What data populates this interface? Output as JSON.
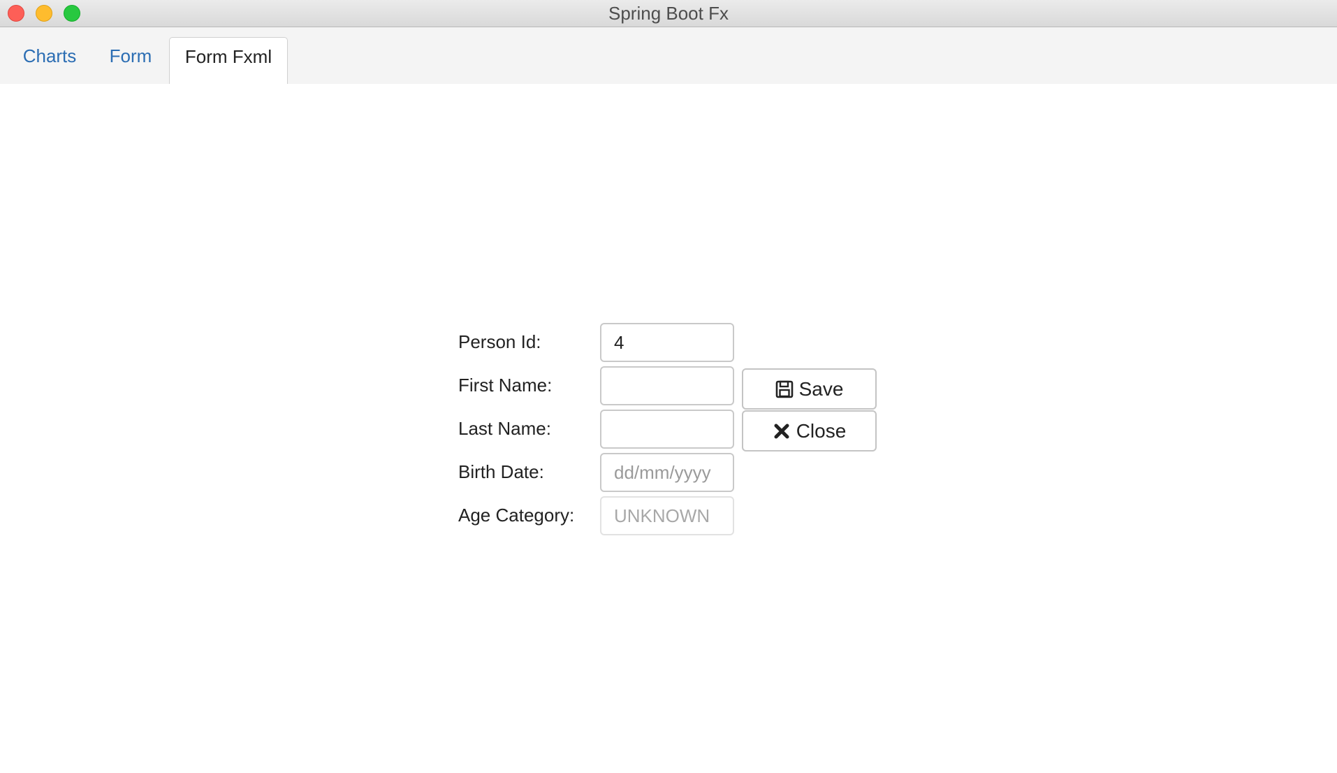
{
  "window": {
    "title": "Spring Boot Fx"
  },
  "tabs": [
    {
      "label": "Charts",
      "selected": false
    },
    {
      "label": "Form",
      "selected": false
    },
    {
      "label": "Form Fxml",
      "selected": true
    }
  ],
  "form": {
    "person_id": {
      "label": "Person Id:",
      "value": "4"
    },
    "first_name": {
      "label": "First Name:",
      "value": ""
    },
    "last_name": {
      "label": "Last Name:",
      "value": ""
    },
    "birth_date": {
      "label": "Birth Date:",
      "value": "",
      "placeholder": "dd/mm/yyyy"
    },
    "age_category": {
      "label": "Age Category:",
      "value": "UNKNOWN"
    }
  },
  "buttons": {
    "save": {
      "label": "Save",
      "icon": "floppy-disk-icon"
    },
    "close": {
      "label": "Close",
      "icon": "x-icon"
    }
  },
  "colors": {
    "tab_link": "#2b6db3",
    "close_light": "#fd5f57",
    "minimize_light": "#febc2e",
    "maximize_light": "#28c840"
  }
}
